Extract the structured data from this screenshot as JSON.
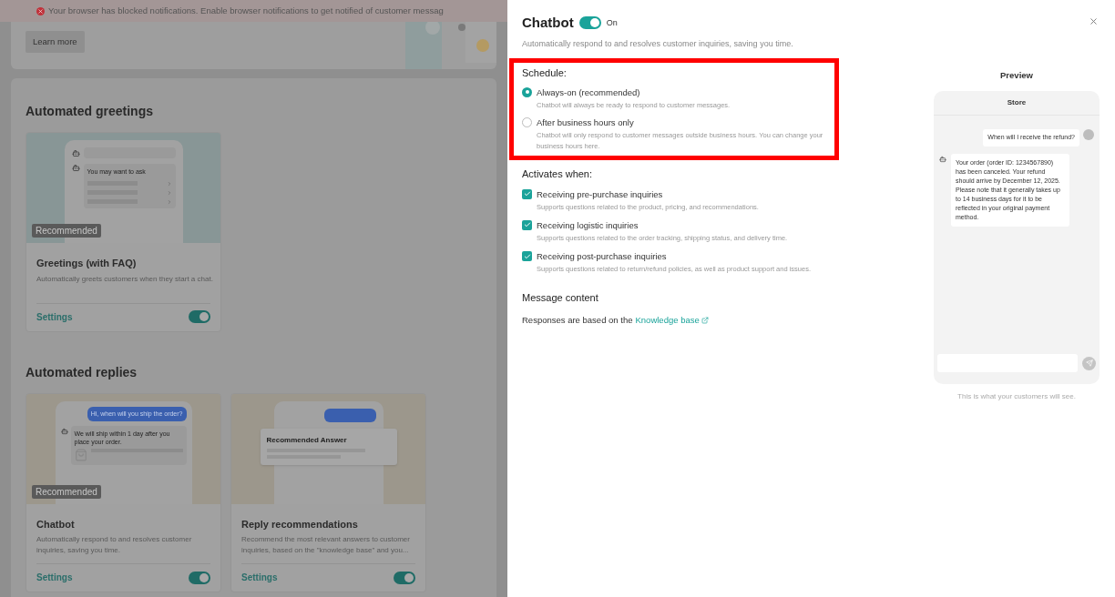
{
  "notification_banner": {
    "text": "Your browser has blocked notifications. Enable browser notifications to get notified of customer messag"
  },
  "intro_card": {
    "button": "Learn more"
  },
  "sections": [
    {
      "title": "Automated greetings",
      "cards": [
        {
          "kind": "greeting",
          "badge": "Recommended",
          "title": "Greetings (with FAQ)",
          "description": "Automatically greets customers when they start a chat.",
          "link": "Settings",
          "on": true,
          "preview_text": "You may want to ask"
        }
      ]
    },
    {
      "title": "Automated replies",
      "cards": [
        {
          "kind": "chatbot",
          "badge": "Recommended",
          "title": "Chatbot",
          "description": "Automatically respond to and resolves customer inquiries, saving you time.",
          "link": "Settings",
          "on": true,
          "preview_question": "Hi, when will you ship the order?",
          "preview_text": "We will ship within 1 day after you place your order."
        },
        {
          "kind": "recommendation",
          "title": "Reply recommendations",
          "description": "Recommend the most relevant answers to customer inquiries, based on the \"knowledge base\" and you...",
          "link": "Settings",
          "on": true,
          "preview_text": "Recommended Answer"
        }
      ]
    }
  ],
  "drawer": {
    "title": "Chatbot",
    "on": true,
    "state_label": "On",
    "description": "Automatically respond to and resolves customer inquiries, saving you time.",
    "schedule": {
      "title": "Schedule:",
      "options": [
        {
          "label": "Always-on (recommended)",
          "description": "Chatbot will always be ready to respond to customer messages.",
          "selected": true
        },
        {
          "label": "After business hours only",
          "description": "Chatbot will only respond to customer messages outside business hours. You can change your business hours here.",
          "selected": false
        }
      ]
    },
    "activates": {
      "title": "Activates when:",
      "items": [
        {
          "label": "Receiving pre-purchase inquiries",
          "description": "Supports questions related to the product, pricing, and recommendations.",
          "checked": true
        },
        {
          "label": "Receiving logistic inquiries",
          "description": "Supports questions related to the order tracking, shipping status, and delivery time.",
          "checked": true
        },
        {
          "label": "Receiving post-purchase inquiries",
          "description": "Supports questions related to return/refund policies, as well as product support and issues.",
          "checked": true
        }
      ]
    },
    "message_content": {
      "title": "Message content",
      "text": "Responses are based on the",
      "link": "Knowledge base"
    },
    "preview": {
      "title": "Preview",
      "store": "Store",
      "messages": [
        {
          "kind": "customer",
          "text": "When will I receive the refund?"
        },
        {
          "kind": "bot",
          "text": "Your order (order ID: 1234567890) has been canceled. Your refund should arrive by December 12, 2025. Please note that it generally takes up to 14 business days for it to be reflected in your original payment method."
        }
      ],
      "caption": "This is what your customers will see."
    }
  }
}
